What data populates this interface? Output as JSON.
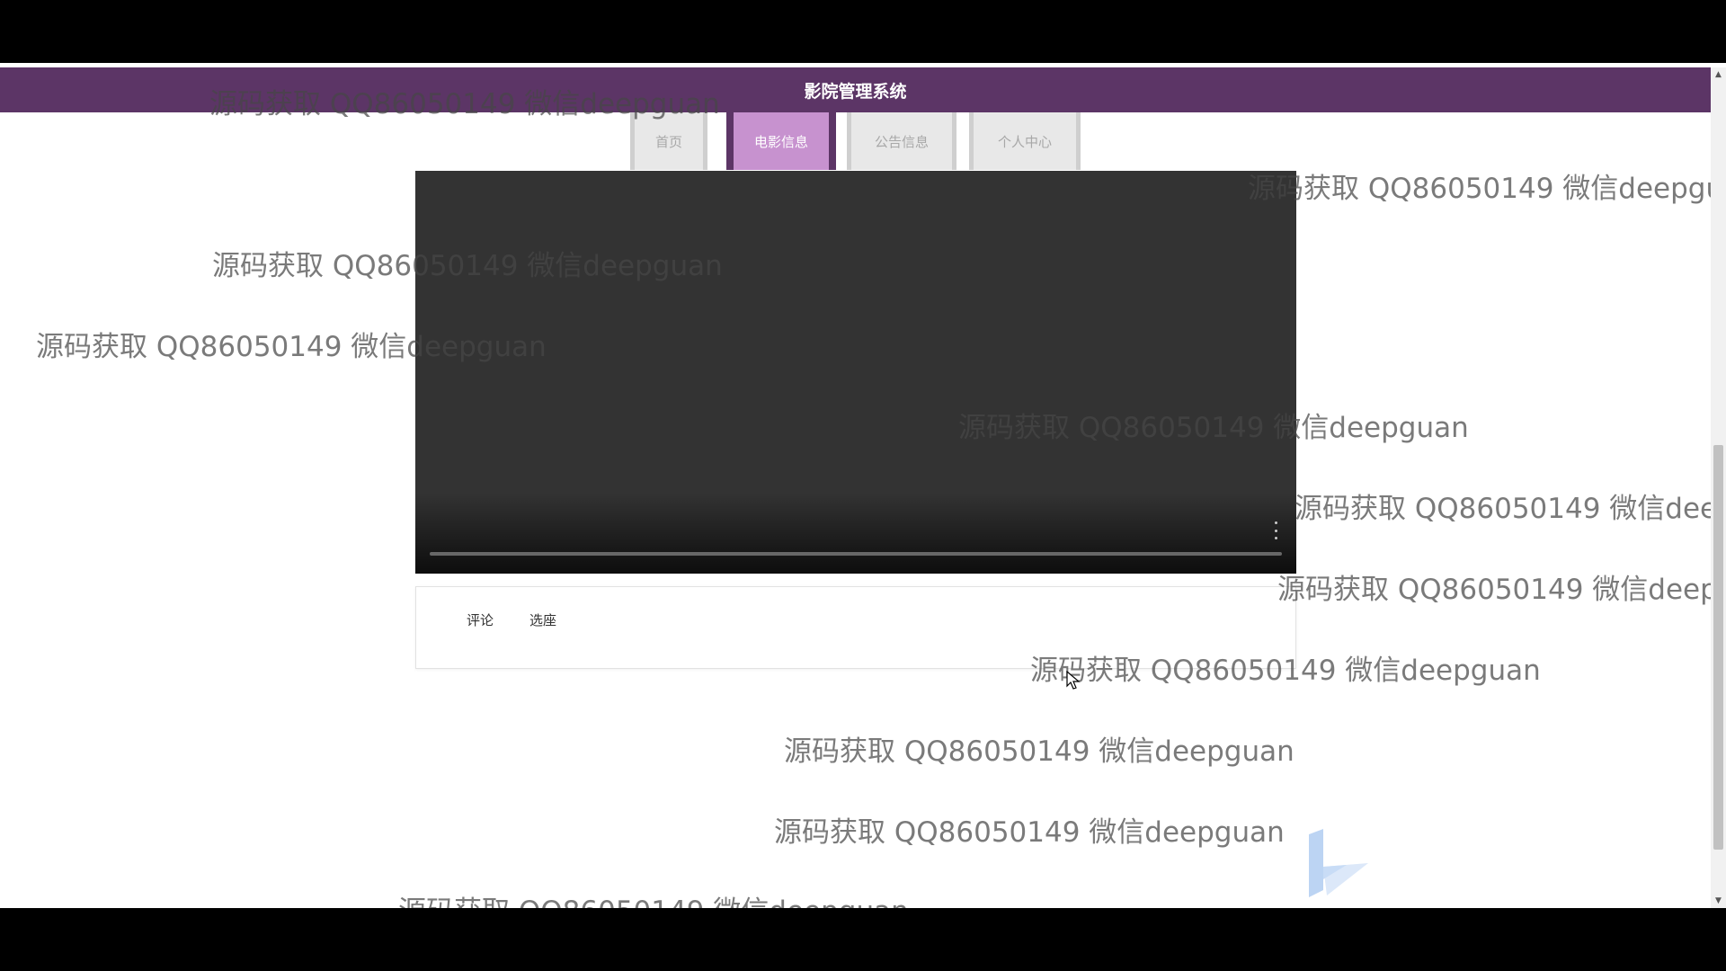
{
  "app": {
    "title": "影院管理系统"
  },
  "nav": {
    "tabs": [
      {
        "label": "首页",
        "active": false
      },
      {
        "label": "电影信息",
        "active": true
      },
      {
        "label": "公告信息",
        "active": false
      },
      {
        "label": "个人中心",
        "active": false
      }
    ]
  },
  "player": {
    "progress": 0
  },
  "actions": {
    "comment_label": "评论",
    "seat_label": "选座"
  },
  "watermark": {
    "text": "源码获取 QQ86050149 微信deepguan"
  },
  "colors": {
    "header": "#5c3566",
    "active_tab": "#c792cf",
    "video_bg": "#333333"
  },
  "icons": [
    "more-vertical-icon",
    "cursor-arrow-icon",
    "logo-icon"
  ]
}
